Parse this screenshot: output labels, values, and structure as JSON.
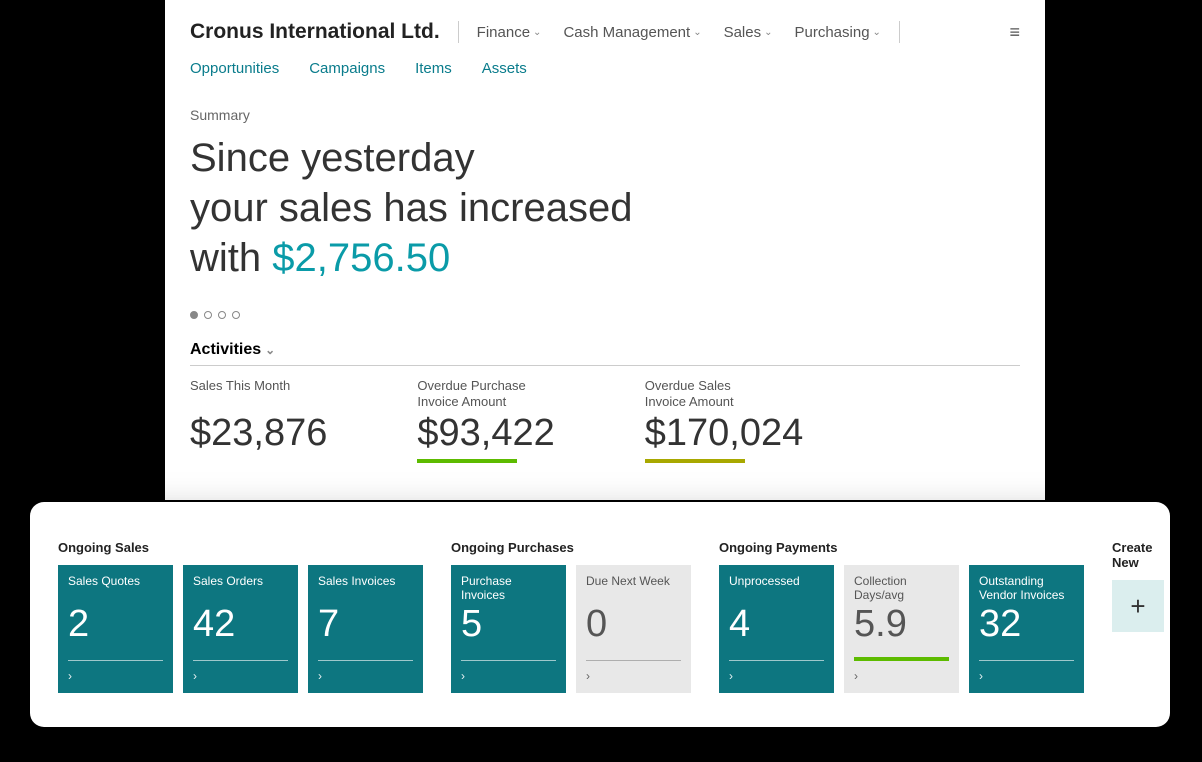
{
  "header": {
    "company": "Cronus International Ltd.",
    "nav": [
      "Finance",
      "Cash Management",
      "Sales",
      "Purchasing"
    ],
    "subnav": [
      "Opportunities",
      "Campaigns",
      "Items",
      "Assets"
    ]
  },
  "summary": {
    "label": "Summary",
    "line1": "Since yesterday",
    "line2": "your sales has increased",
    "line3_prefix": "with ",
    "amount": "$2,756.50"
  },
  "activities": {
    "title": "Activities",
    "items": [
      {
        "label": "Sales This Month",
        "value": "$23,876",
        "bar": ""
      },
      {
        "label": "Overdue Purchase\nInvoice Amount",
        "value": "$93,422",
        "bar": "green"
      },
      {
        "label": "Overdue Sales\nInvoice Amount",
        "value": "$170,024",
        "bar": "olive"
      }
    ]
  },
  "ongoing": {
    "sales": {
      "title": "Ongoing Sales",
      "tiles": [
        {
          "label": "Sales Quotes",
          "value": "2",
          "style": "teal"
        },
        {
          "label": "Sales Orders",
          "value": "42",
          "style": "teal"
        },
        {
          "label": "Sales Invoices",
          "value": "7",
          "style": "teal"
        }
      ]
    },
    "purchases": {
      "title": "Ongoing Purchases",
      "tiles": [
        {
          "label": "Purchase Invoices",
          "value": "5",
          "style": "teal"
        },
        {
          "label": "Due Next Week",
          "value": "0",
          "style": "grey"
        }
      ]
    },
    "payments": {
      "title": "Ongoing Payments",
      "tiles": [
        {
          "label": "Unprocessed",
          "value": "4",
          "style": "teal"
        },
        {
          "label": "Collection Days/avg",
          "value": "5.9",
          "style": "grey",
          "bar": "green"
        },
        {
          "label": "Outstanding Vendor Invoices",
          "value": "32",
          "style": "teal"
        }
      ]
    },
    "create": {
      "title": "Create New"
    }
  }
}
